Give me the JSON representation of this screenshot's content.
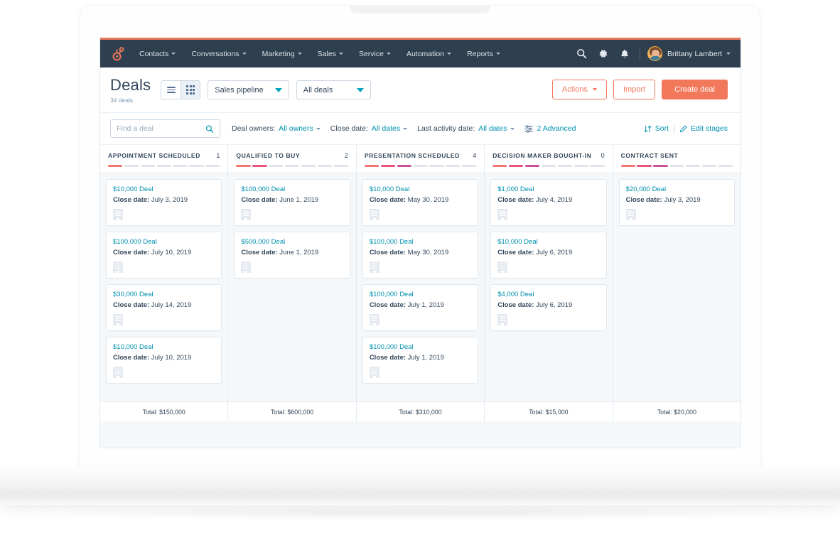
{
  "topnav": {
    "logo_name": "hubspot-sprocket-logo",
    "links": [
      {
        "label": "Contacts"
      },
      {
        "label": "Conversations"
      },
      {
        "label": "Marketing"
      },
      {
        "label": "Sales"
      },
      {
        "label": "Service"
      },
      {
        "label": "Automation"
      },
      {
        "label": "Reports"
      }
    ],
    "icons": [
      "search-icon",
      "gear-icon",
      "bell-icon"
    ],
    "user": "Brittany Lambert"
  },
  "pagehead": {
    "title": "Deals",
    "subtitle": "34 deals",
    "view_list_label": "list-view",
    "view_board_label": "board-view",
    "pipeline_select": "Sales pipeline",
    "view_select": "All deals",
    "actions_label": "Actions",
    "import_label": "Import",
    "create_label": "Create deal"
  },
  "filterbar": {
    "search_placeholder": "Find a deal",
    "search_value": "",
    "deal_owners_label": "Deal owners:",
    "deal_owners_value": "All owners",
    "close_date_label": "Close date:",
    "close_date_value": "All dates",
    "last_activity_label": "Last activity date:",
    "last_activity_value": "All dates",
    "advanced_label": "2 Advanced",
    "sort_label": "Sort",
    "edit_stages_label": "Edit stages"
  },
  "board": {
    "total_prefix": "Total: ",
    "columns": [
      {
        "name": "APPOINTMENT SCHEDULED",
        "count": "1",
        "segments_filled": 1,
        "total": "Total: $150,000",
        "cards": [
          {
            "title": "$10,000 Deal",
            "date_label": "Close date:",
            "date": "July 3, 2019"
          },
          {
            "title": "$100,000 Deal",
            "date_label": "Close date:",
            "date": "July 10, 2019"
          },
          {
            "title": "$30,000 Deal",
            "date_label": "Close date:",
            "date": "July 14, 2019"
          },
          {
            "title": "$10,000 Deal",
            "date_label": "Close date:",
            "date": "July 10, 2019"
          }
        ]
      },
      {
        "name": "QUALIFIED TO BUY",
        "count": "2",
        "segments_filled": 2,
        "total": "Total: $600,000",
        "cards": [
          {
            "title": "$100,000 Deal",
            "date_label": "Close date:",
            "date": "June 1, 2019"
          },
          {
            "title": "$500,000 Deal",
            "date_label": "Close date:",
            "date": "June 1, 2019"
          }
        ]
      },
      {
        "name": "PRESENTATION SCHEDULED",
        "count": "4",
        "segments_filled": 3,
        "total": "Total: $310,000",
        "cards": [
          {
            "title": "$10,000 Deal",
            "date_label": "Close date:",
            "date": "May 30, 2019"
          },
          {
            "title": "$100,000 Deal",
            "date_label": "Close date:",
            "date": "May 30, 2019"
          },
          {
            "title": "$100,000 Deal",
            "date_label": "Close date:",
            "date": "July 1, 2019"
          },
          {
            "title": "$100,000 Deal",
            "date_label": "Close date:",
            "date": "July 1, 2019"
          }
        ]
      },
      {
        "name": "DECISION MAKER BOUGHT-IN",
        "count": "0",
        "segments_filled": 3,
        "total": "Total: $15,000",
        "cards": [
          {
            "title": "$1,000 Deal",
            "date_label": "Close date:",
            "date": "July 4, 2019"
          },
          {
            "title": "$10,000 Deal",
            "date_label": "Close date:",
            "date": "July 6, 2019"
          },
          {
            "title": "$4,000 Deal",
            "date_label": "Close date:",
            "date": "July 6, 2019"
          }
        ]
      },
      {
        "name": "CONTRACT SENT",
        "count": "",
        "segments_filled": 3,
        "total": "Total: $20,000",
        "cards": [
          {
            "title": "$20,000 Deal",
            "date_label": "Close date:",
            "date": "July 3, 2019"
          }
        ]
      }
    ]
  },
  "colors": {
    "nav_bg": "#2e3f50",
    "nav_accent": "#e8765a",
    "primary": "#f2785c",
    "link": "#0091ae",
    "text": "#33475b",
    "segment_1": "#f2776e",
    "segment_2": "#e8547e",
    "segment_3": "#c9519c",
    "segment_empty": "#dfe3eb"
  }
}
